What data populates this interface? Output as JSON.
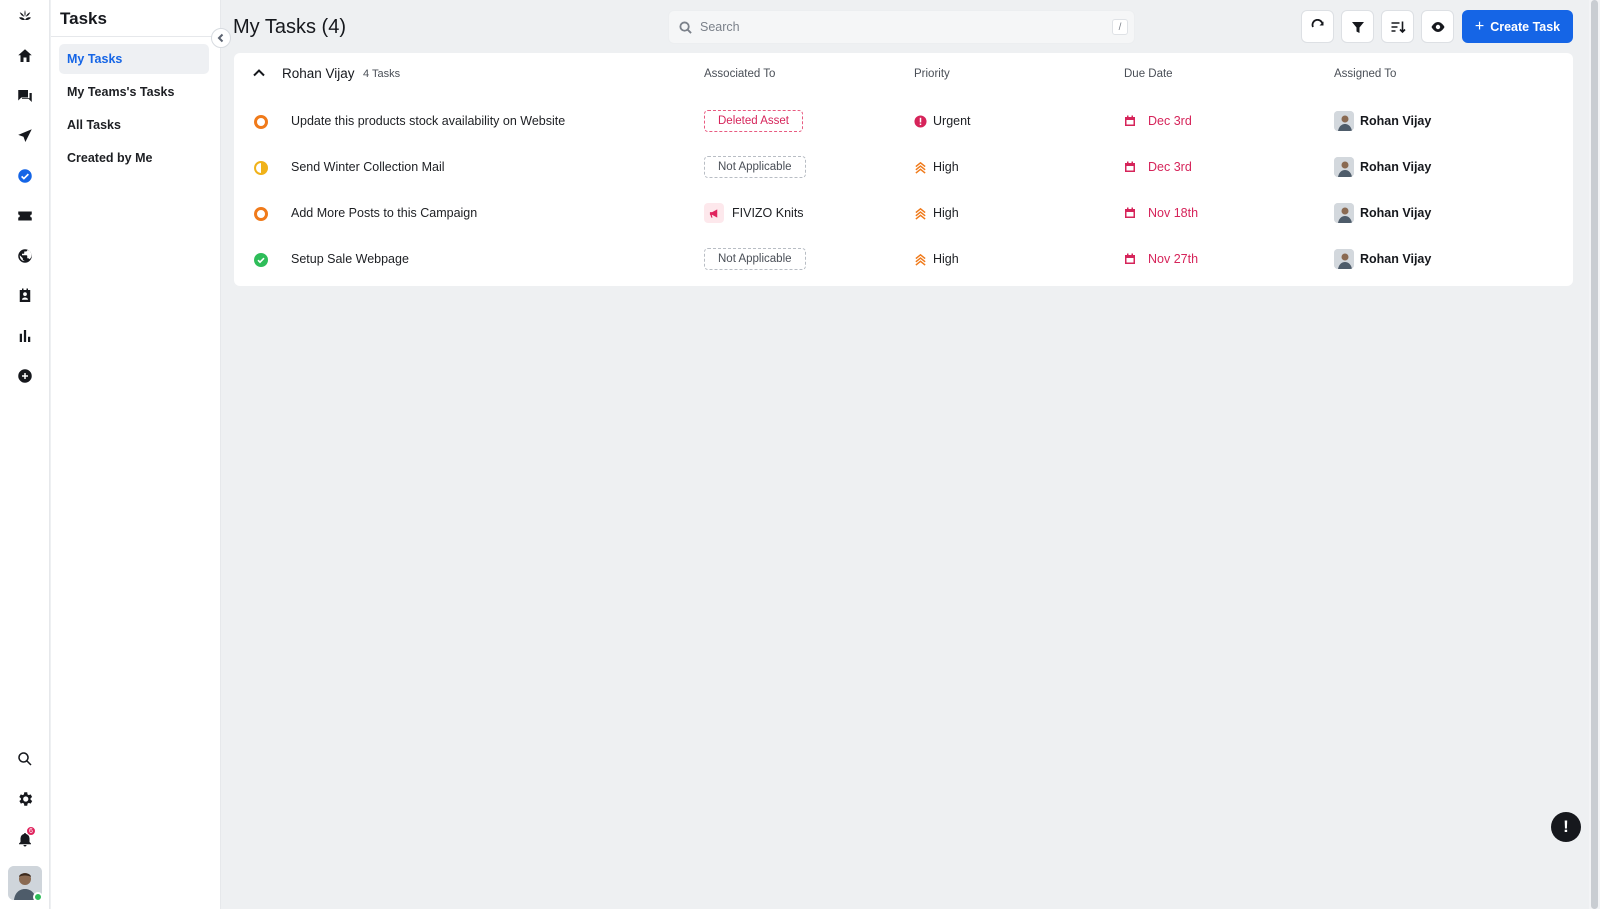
{
  "sidebar": {
    "title": "Tasks",
    "items": [
      {
        "label": "My Tasks",
        "active": true
      },
      {
        "label": "My Teams's Tasks"
      },
      {
        "label": "All Tasks"
      },
      {
        "label": "Created by Me"
      }
    ]
  },
  "rail": {
    "notification_count": "6",
    "icons": [
      "logo-icon",
      "home-icon",
      "chat-icon",
      "send-icon",
      "tasks-icon",
      "ticket-icon",
      "globe-icon",
      "contacts-icon",
      "reports-icon",
      "add-circle-icon",
      "search-icon",
      "settings-icon",
      "bell-icon"
    ]
  },
  "header": {
    "title": "My Tasks (4)",
    "search_placeholder": "Search",
    "search_shortcut": "/",
    "create_label": "Create Task"
  },
  "group": {
    "name": "Rohan Vijay",
    "count_label": "4 Tasks"
  },
  "columns": {
    "associated": "Associated To",
    "priority": "Priority",
    "due": "Due Date",
    "assigned": "Assigned To"
  },
  "tasks": [
    {
      "title": "Update this products stock availability on Website",
      "status_color": "#f07a1a",
      "associated": "Deleted Asset",
      "associated_type": "deleted",
      "priority": "Urgent",
      "due": "Dec 3rd",
      "assignee": "Rohan Vijay"
    },
    {
      "title": "Send Winter Collection Mail",
      "status_color": "#f0b21a",
      "associated": "Not Applicable",
      "associated_type": "na",
      "priority": "High",
      "due": "Dec 3rd",
      "assignee": "Rohan Vijay"
    },
    {
      "title": "Add More Posts to this Campaign",
      "status_color": "#f07a1a",
      "associated": "FIVIZO Knits",
      "associated_type": "link",
      "priority": "High",
      "due": "Nov 18th",
      "assignee": "Rohan Vijay"
    },
    {
      "title": "Setup Sale Webpage",
      "status_color": "#2ebd59",
      "associated": "Not Applicable",
      "associated_type": "na",
      "priority": "High",
      "due": "Nov 27th",
      "assignee": "Rohan Vijay"
    }
  ],
  "colors": {
    "accent": "#1565e6",
    "due": "#d6245a",
    "urgent": "#d6245a",
    "high": "#f07a1a"
  }
}
